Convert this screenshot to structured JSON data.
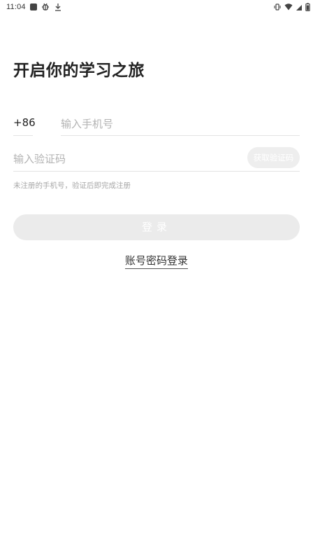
{
  "status_bar": {
    "time": "11:04",
    "left_icons": [
      "square-notification-icon",
      "bug-icon",
      "download-icon"
    ],
    "right_icons": [
      "vibrate-icon",
      "wifi-icon",
      "signal-icon",
      "battery-icon"
    ]
  },
  "page": {
    "title": "开启你的学习之旅"
  },
  "login_form": {
    "country_code": "+86",
    "phone_placeholder": "输入手机号",
    "code_placeholder": "输入验证码",
    "get_code_label": "获取验证码",
    "hint": "未注册的手机号，验证后即完成注册",
    "login_label": "登录",
    "account_login_link": "账号密码登录"
  },
  "colors": {
    "title": "#222222",
    "placeholder": "#b3b3b3",
    "divider": "#e3e3e3",
    "button_disabled_bg": "#ebebeb",
    "hint": "#a8a8a8"
  }
}
